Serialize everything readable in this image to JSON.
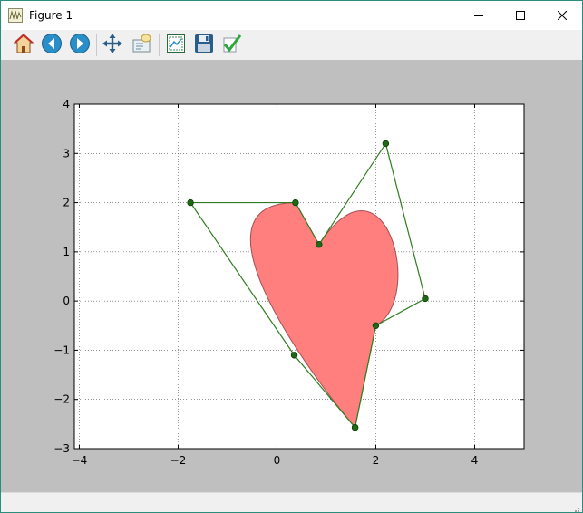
{
  "window": {
    "title": "Figure 1",
    "icon": "matplotlib-figure-icon"
  },
  "toolbar": {
    "items": [
      {
        "name": "home",
        "icon": "home-icon"
      },
      {
        "name": "back",
        "icon": "back-arrow-icon"
      },
      {
        "name": "forward",
        "icon": "forward-arrow-icon"
      },
      {
        "name": "pan",
        "icon": "pan-move-icon"
      },
      {
        "name": "zoom",
        "icon": "zoom-rect-icon"
      },
      {
        "name": "subplots",
        "icon": "configure-subplots-icon"
      },
      {
        "name": "save",
        "icon": "save-floppy-icon"
      },
      {
        "name": "edit",
        "icon": "edit-checkmark-icon"
      }
    ]
  },
  "colors": {
    "figure_background": "#bfbfbf",
    "axes_background": "#ffffff",
    "shape_fill": "#ff7f7f",
    "shape_edge": "#a05050",
    "control_polygon": "#2e7d1e",
    "vertex_marker": "#1e6a14"
  },
  "chart_data": {
    "type": "line",
    "title": "",
    "xlabel": "",
    "ylabel": "",
    "xlim": [
      -4.1,
      5
    ],
    "ylim": [
      -3,
      4
    ],
    "xticks": [
      -4,
      -2,
      0,
      2,
      4
    ],
    "yticks": [
      -3,
      -2,
      -1,
      0,
      1,
      2,
      3,
      4
    ],
    "xtick_labels": [
      "−4",
      "−2",
      "0",
      "2",
      "4"
    ],
    "ytick_labels": [
      "−3",
      "−2",
      "−1",
      "0",
      "1",
      "2",
      "3",
      "4"
    ],
    "grid": true,
    "grid_style": "dotted",
    "series": [
      {
        "kind": "bezier_path_control_polygon",
        "marker": "circle",
        "points": [
          [
            1.58,
            -2.57
          ],
          [
            0.35,
            -1.1
          ],
          [
            -1.75,
            2.0
          ],
          [
            0.375,
            2.0
          ],
          [
            0.85,
            1.15
          ],
          [
            2.2,
            3.2
          ],
          [
            3.0,
            0.05
          ],
          [
            2.0,
            -0.5
          ],
          [
            1.58,
            -2.57
          ]
        ]
      },
      {
        "kind": "filled_bezier_shape",
        "alpha": 0.5,
        "segments": [
          [
            [
              1.58,
              -2.57
            ],
            [
              0.35,
              -1.1
            ],
            [
              -1.75,
              2.0
            ],
            [
              0.375,
              2.0
            ]
          ],
          [
            [
              0.375,
              2.0
            ],
            [
              0.85,
              1.15
            ]
          ],
          [
            [
              0.85,
              1.15
            ],
            [
              2.2,
              3.2
            ],
            [
              3.0,
              0.05
            ],
            [
              2.0,
              -0.5
            ]
          ],
          [
            [
              2.0,
              -0.5
            ],
            [
              1.58,
              -2.57
            ]
          ]
        ]
      }
    ]
  }
}
